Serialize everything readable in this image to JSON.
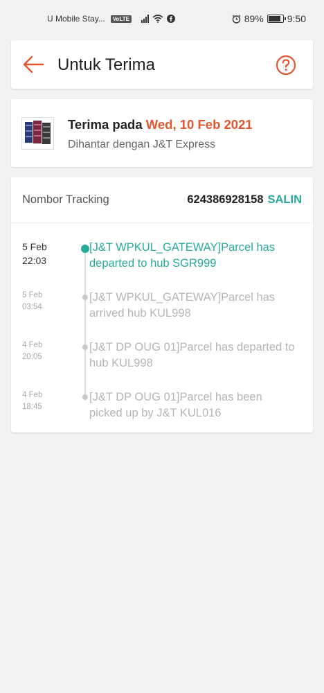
{
  "status_bar": {
    "carrier": "U Mobile Stay...",
    "volte": "VoLTE",
    "battery": "89%",
    "time": "9:50"
  },
  "header": {
    "title": "Untuk Terima",
    "back_icon": "arrow-left-icon",
    "help_icon": "question-circle-icon"
  },
  "delivery": {
    "receive_prefix": "Terima pada",
    "receive_date": "Wed, 10 Feb 2021",
    "courier": "Dihantar dengan J&T Express"
  },
  "tracking": {
    "label": "Nombor Tracking",
    "number": "624386928158",
    "copy_label": "SALIN",
    "events": [
      {
        "date": "5 Feb",
        "time": "22:03",
        "text": "[J&T WPKUL_GATEWAY]Parcel has departed to hub SGR999"
      },
      {
        "date": "5 Feb",
        "time": "03:54",
        "text": "[J&T WPKUL_GATEWAY]Parcel has arrived hub KUL998"
      },
      {
        "date": "4 Feb",
        "time": "20:05",
        "text": "[J&T DP OUG 01]Parcel has departed to hub KUL998"
      },
      {
        "date": "4 Feb",
        "time": "18:45",
        "text": "[J&T DP OUG 01]Parcel has been picked up by J&T KUL016"
      }
    ]
  },
  "colors": {
    "accent_orange": "#e2562f",
    "accent_teal": "#26aa99",
    "background": "#f2f2f2"
  }
}
